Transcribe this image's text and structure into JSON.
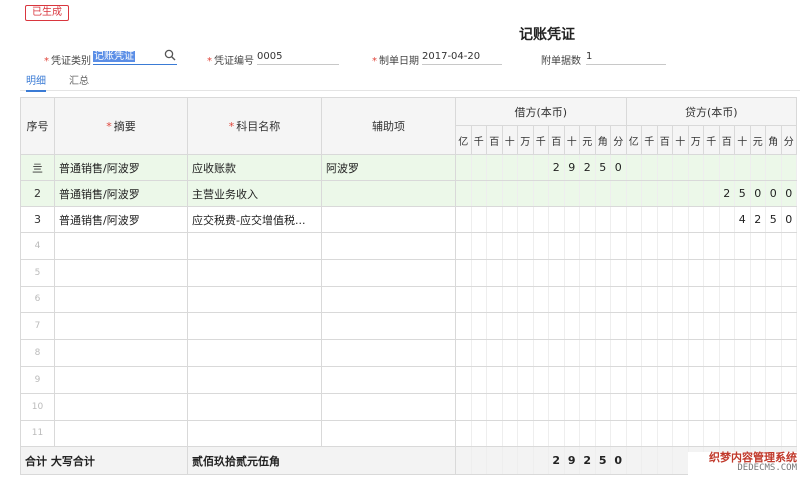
{
  "status_badge": "已生成",
  "title": "记账凭证",
  "header": {
    "category_label": "凭证类别",
    "category_value": "记账凭证",
    "number_label": "凭证编号",
    "number_value": "0005",
    "date_label": "制单日期",
    "date_value": "2017-04-20",
    "attach_label": "附单据数",
    "attach_value": "1"
  },
  "tabs": [
    "明细",
    "汇总"
  ],
  "columns": {
    "seq": "序号",
    "summary": "摘要",
    "account": "科目名称",
    "aux": "辅助项",
    "debit": "借方(本币)",
    "credit": "贷方(本币)",
    "digits": [
      "亿",
      "千",
      "百",
      "十",
      "万",
      "千",
      "百",
      "十",
      "元",
      "角",
      "分"
    ]
  },
  "rows": [
    {
      "seq": "亖",
      "summary": "普通销售/阿波罗",
      "account": "应收账款",
      "aux": "阿波罗",
      "debit": [
        "",
        "",
        "",
        "",
        "",
        "",
        "2",
        "9",
        "2",
        "5",
        "0"
      ],
      "credit": [
        "",
        "",
        "",
        "",
        "",
        "",
        "",
        "",
        "",
        "",
        ""
      ]
    },
    {
      "seq": "2",
      "summary": "普通销售/阿波罗",
      "account": "主营业务收入",
      "aux": "",
      "debit": [
        "",
        "",
        "",
        "",
        "",
        "",
        "",
        "",
        "",
        "",
        ""
      ],
      "credit": [
        "",
        "",
        "",
        "",
        "",
        "",
        "2",
        "5",
        "0",
        "0",
        "0"
      ]
    },
    {
      "seq": "3",
      "summary": "普通销售/阿波罗",
      "account": "应交税费-应交增值税...",
      "aux": "",
      "debit": [
        "",
        "",
        "",
        "",
        "",
        "",
        "",
        "",
        "",
        "",
        ""
      ],
      "credit": [
        "",
        "",
        "",
        "",
        "",
        "",
        "",
        "4",
        "2",
        "5",
        "0"
      ]
    }
  ],
  "empty_rows": [
    "4",
    "5",
    "6",
    "7",
    "8",
    "9",
    "10",
    "11"
  ],
  "total": {
    "label": "合计",
    "caps_label": "大写合计",
    "caps_value": "贰佰玖拾贰元伍角",
    "debit": [
      "",
      "",
      "",
      "",
      "",
      "",
      "2",
      "9",
      "2",
      "5",
      "0"
    ],
    "credit": [
      "",
      "",
      "",
      "",
      "",
      "",
      "",
      "",
      "",
      "",
      ""
    ]
  },
  "watermark": {
    "line1": "织梦内容管理系统",
    "line2": "DEDECMS.COM"
  }
}
